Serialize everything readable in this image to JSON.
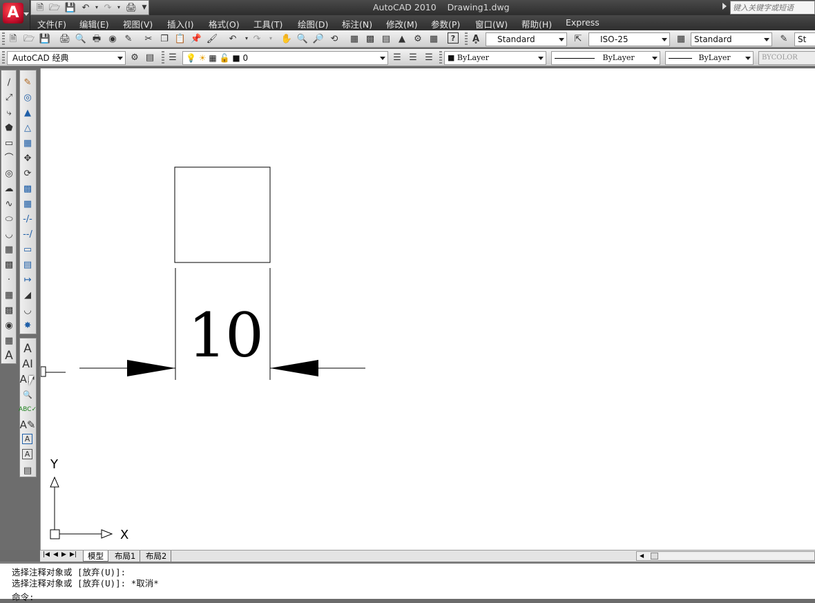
{
  "title_bar": {
    "app_title": "AutoCAD 2010",
    "document": "Drawing1.dwg",
    "search_placeholder": "键入关键字或短语"
  },
  "menu": [
    "文件(F)",
    "编辑(E)",
    "视图(V)",
    "插入(I)",
    "格式(O)",
    "工具(T)",
    "绘图(D)",
    "标注(N)",
    "修改(M)",
    "参数(P)",
    "窗口(W)",
    "帮助(H)",
    "Express"
  ],
  "styles_toolbar": {
    "text_style": "Standard",
    "dim_style": "ISO-25",
    "table_style": "Standard",
    "multileader_style": "St"
  },
  "workspace_toolbar": {
    "workspace": "AutoCAD 经典",
    "layer": "0"
  },
  "properties_toolbar": {
    "color": "ByLayer",
    "linetype": "ByLayer",
    "lineweight": "ByLayer",
    "plotstyle": "BYCOLOR"
  },
  "drawing": {
    "dimension_text": "10",
    "ucs_x": "X",
    "ucs_y": "Y"
  },
  "layout_tabs": [
    "模型",
    "布局1",
    "布局2"
  ],
  "command_line": [
    "选择注释对象或 [放弃(U)]:",
    "选择注释对象或 [放弃(U)]: *取消*",
    "命令:"
  ],
  "colors": {
    "title_bg": "#3a3a3a",
    "toolbar_bg": "#e2e2e2",
    "canvas_bg": "#ffffff",
    "app_icon_red": "#c8102e"
  }
}
